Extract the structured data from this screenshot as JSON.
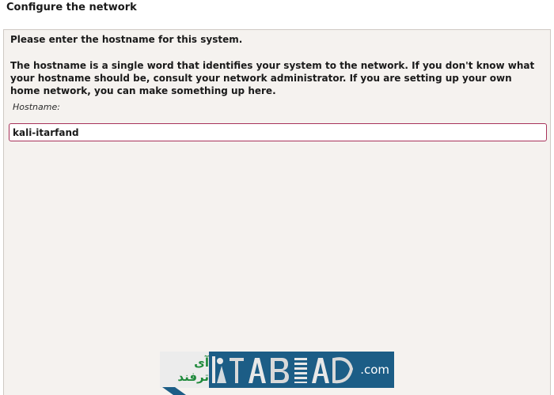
{
  "header": {
    "title": "Configure the network"
  },
  "form": {
    "prompt": "Please enter the hostname for this system.",
    "description": "The hostname is a single word that identifies your system to the network. If you don't know what your hostname should be, consult your network administrator. If you are setting up your own home network, you can make something up here.",
    "field_label": "Hostname:",
    "hostname_value": "kali-itarfand"
  },
  "watermark": {
    "persian_text": "آی ترفند",
    "domain_suffix": ".com"
  },
  "colors": {
    "input_border": "#a8325b",
    "panel_bg": "#f5f2ef",
    "watermark_bg": "#1c5d86"
  }
}
